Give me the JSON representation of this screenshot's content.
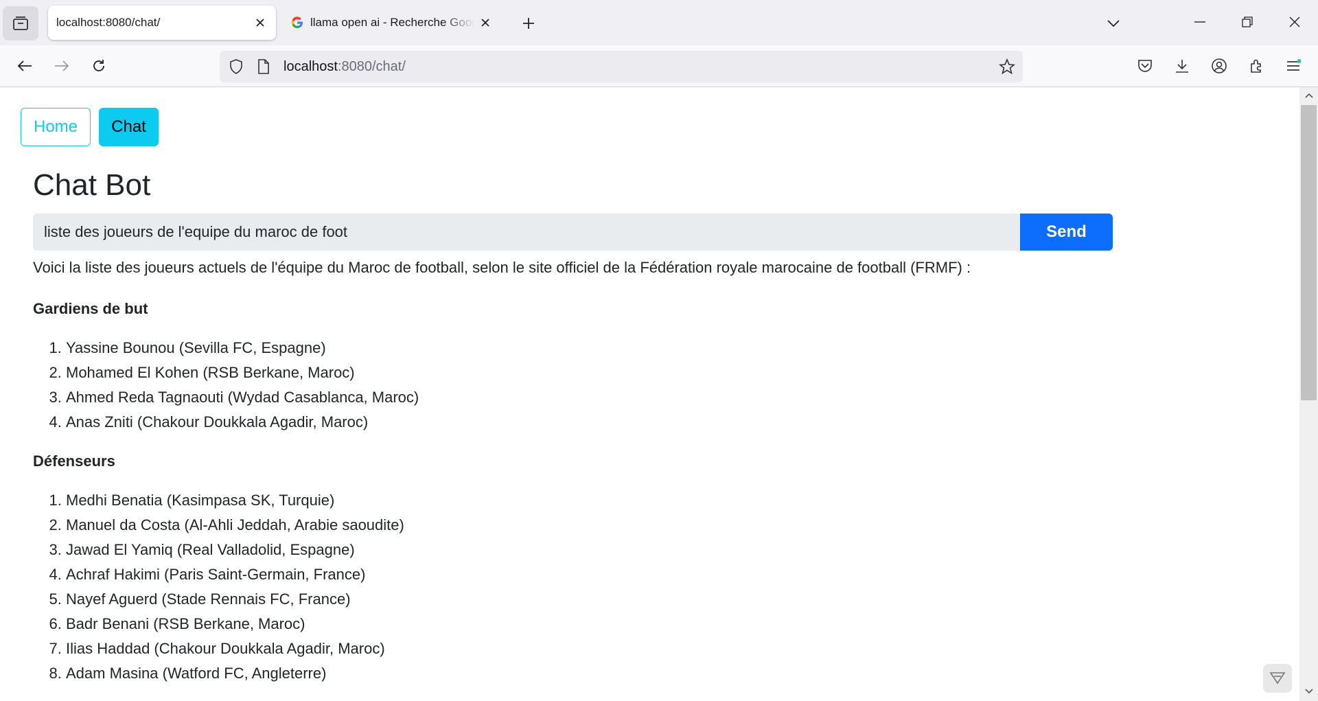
{
  "browser": {
    "tabs": [
      {
        "title": "localhost:8080/chat/",
        "active": true
      },
      {
        "title": "llama open ai - Recherche Google",
        "active": false
      }
    ],
    "url": {
      "host": "localhost",
      "rest": ":8080/chat/"
    },
    "icons": [
      "tab-list-icon",
      "close-icon",
      "google-icon",
      "new-tab-icon",
      "chevron-down-icon",
      "minimize-icon",
      "restore-icon",
      "window-close-icon",
      "back-icon",
      "forward-icon",
      "reload-icon",
      "shield-icon",
      "page-icon",
      "bookmark-star-icon",
      "pocket-icon",
      "download-icon",
      "account-icon",
      "extensions-icon",
      "menu-icon"
    ]
  },
  "nav": {
    "home": "Home",
    "chat": "Chat"
  },
  "page": {
    "title": "Chat Bot",
    "input_value": "liste des joueurs de l'equipe du maroc de foot",
    "send_label": "Send"
  },
  "answer": {
    "intro": "Voici la liste des joueurs actuels de l'équipe du Maroc de football, selon le site officiel de la Fédération royale marocaine de football (FRMF) :",
    "sections": [
      {
        "heading": "Gardiens de but",
        "players": [
          "Yassine Bounou (Sevilla FC, Espagne)",
          "Mohamed El Kohen (RSB Berkane, Maroc)",
          "Ahmed Reda Tagnaouti (Wydad Casablanca, Maroc)",
          "Anas Zniti (Chakour Doukkala Agadir, Maroc)"
        ]
      },
      {
        "heading": "Défenseurs",
        "players": [
          "Medhi Benatia (Kasimpasa SK, Turquie)",
          "Manuel da Costa (Al-Ahli Jeddah, Arabie saoudite)",
          "Jawad El Yamiq (Real Valladolid, Espagne)",
          "Achraf Hakimi (Paris Saint-Germain, France)",
          "Nayef Aguerd (Stade Rennais FC, France)",
          "Badr Benani (RSB Berkane, Maroc)",
          "Ilias Haddad (Chakour Doukkala Agadir, Maroc)",
          "Adam Masina (Watford FC, Angleterre)"
        ]
      }
    ]
  }
}
